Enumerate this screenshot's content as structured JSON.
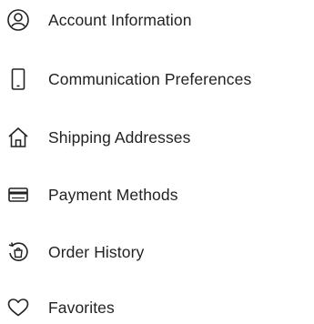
{
  "account_menu": {
    "items": [
      {
        "label": "Account Information",
        "icon": "user-circle-icon"
      },
      {
        "label": "Communication Preferences",
        "icon": "mobile-phone-icon"
      },
      {
        "label": "Shipping Addresses",
        "icon": "home-icon"
      },
      {
        "label": "Payment Methods",
        "icon": "credit-card-icon"
      },
      {
        "label": "Order History",
        "icon": "order-history-icon"
      },
      {
        "label": "Favorites",
        "icon": "heart-icon"
      }
    ]
  }
}
